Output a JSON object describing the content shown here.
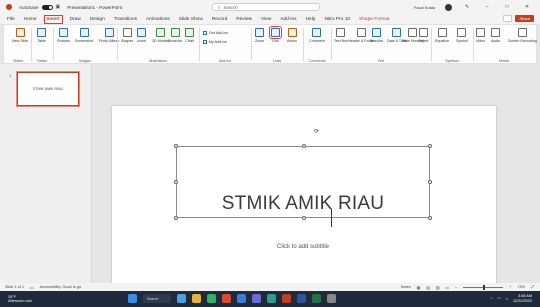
{
  "titlebar": {
    "autosave_label": "AutoSave",
    "autosave_state": "On",
    "doc_title": "Presentation1 - PowerPoint",
    "search_placeholder": "Search",
    "user_name": "Fauzi Koala"
  },
  "tabs": [
    "File",
    "Home",
    "Insert",
    "Draw",
    "Design",
    "Transitions",
    "Animations",
    "Slide Show",
    "Record",
    "Review",
    "View",
    "Add-ins",
    "Help",
    "Nitro Pro 10",
    "Shape Format"
  ],
  "active_tab": "Insert",
  "share_label": "Share",
  "ribbon": {
    "groups": {
      "slides": "Slides",
      "tables": "Tables",
      "images": "Images",
      "illustrations": "Illustrations",
      "addins": "Add-ins",
      "links": "Links",
      "comments": "Comments",
      "text": "Text",
      "symbols": "Symbols",
      "media": "Media"
    },
    "buttons": {
      "new_slide": "New Slide",
      "table": "Table",
      "pictures": "Pictures",
      "screenshot": "Screenshot",
      "photo_album": "Photo Album",
      "shapes": "Shapes",
      "icons": "Icons",
      "models": "3D Models",
      "smartart": "SmartArt",
      "chart": "Chart",
      "get_addins": "Get Add-ins",
      "my_addins": "My Add-ins",
      "zoom": "Zoom",
      "link": "Link",
      "action": "Action",
      "comment": "Comment",
      "text_box": "Text Box",
      "header_footer": "Header & Footer",
      "wordart": "WordArt",
      "date_time": "Date & Time",
      "slide_number": "Slide Number",
      "object": "Object",
      "equation": "Equation",
      "symbol": "Symbol",
      "video": "Video",
      "audio": "Audio",
      "screen_recording": "Screen Recording"
    }
  },
  "thumbnails": {
    "slide_number": "1",
    "text": "STMIK AMIK RIAU"
  },
  "slide": {
    "title": "STMIK AMIK RIAU",
    "subtitle_placeholder": "Click to add subtitle"
  },
  "statusbar": {
    "slide_counter": "Slide 1 of 1",
    "accessibility": "Accessibility: Good to go",
    "notes": "Notes",
    "zoom": "73%"
  },
  "taskbar": {
    "weather_temp": "29°F",
    "weather_desc": "Afternoon rain",
    "search_label": "Search",
    "time": "3:58 AM",
    "date": "12/22/2022"
  },
  "colors": {
    "accent": "#c43e1c",
    "highlight": "#e03a3a",
    "taskbar": "#1f2a3a"
  }
}
